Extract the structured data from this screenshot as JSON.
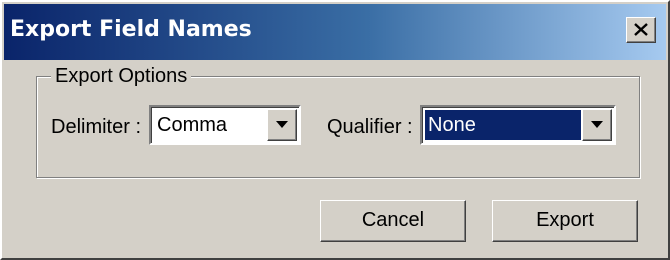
{
  "window": {
    "title": "Export Field Names"
  },
  "icons": {
    "close": "close-icon",
    "dropdown": "chevron-down-icon"
  },
  "colors": {
    "title_gradient_start": "#0a246a",
    "title_gradient_end": "#a6caf0",
    "dialog_background": "#d4d0c8",
    "selection": "#0a246a"
  },
  "export_options": {
    "group_label": "Export Options",
    "delimiter": {
      "label": "Delimiter :",
      "value": "Comma"
    },
    "qualifier": {
      "label": "Qualifier :",
      "value": "None"
    }
  },
  "buttons": {
    "cancel": "Cancel",
    "export": "Export"
  }
}
